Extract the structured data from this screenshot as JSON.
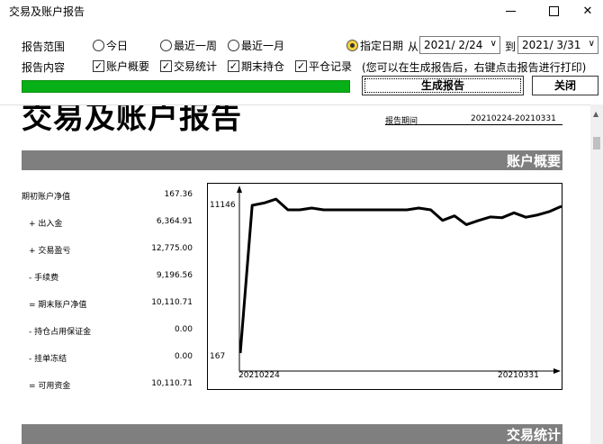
{
  "window": {
    "title": "交易及账户报告"
  },
  "controls": {
    "range_label": "报告范围",
    "content_label": "报告内容",
    "radios": [
      {
        "label": "今日",
        "checked": false
      },
      {
        "label": "最近一周",
        "checked": false
      },
      {
        "label": "最近一月",
        "checked": false
      },
      {
        "label": "指定日期",
        "checked": true
      }
    ],
    "from_label": "从",
    "to_label": "到",
    "from_date": "2021/ 2/24",
    "to_date": "2021/ 3/31",
    "checkboxes": [
      {
        "label": "账户概要",
        "checked": true
      },
      {
        "label": "交易统计",
        "checked": true
      },
      {
        "label": "期末持仓",
        "checked": true
      },
      {
        "label": "平仓记录",
        "checked": true
      }
    ],
    "hint": "(您可以在生成报告后，右键点击报告进行打印)",
    "progress": 1.0,
    "generate_button": "生成报告",
    "close_button": "关闭"
  },
  "report": {
    "title": "交易及账户报告",
    "period_label": "报告期间",
    "period_value": "20210224-20210331",
    "section_account": "账户概要",
    "section_stats": "交易统计",
    "summary": [
      {
        "label": "期初账户净值",
        "value": "167.36"
      },
      {
        "label": "+ 出入金",
        "value": "6,364.91"
      },
      {
        "label": "+ 交易盈亏",
        "value": "12,775.00"
      },
      {
        "label": "- 手续费",
        "value": "9,196.56"
      },
      {
        "label": "= 期末账户净值",
        "value": "10,110.71"
      },
      {
        "label": "- 持仓占用保证金",
        "value": "0.00"
      },
      {
        "label": "- 挂单冻结",
        "value": "0.00"
      },
      {
        "label": "= 可用资金",
        "value": "10,110.71"
      }
    ]
  },
  "chart_data": {
    "type": "line",
    "x_start_label": "20210224",
    "x_end_label": "20210331",
    "y_top_label": "11146",
    "y_bottom_label": "167",
    "ylim": [
      167,
      11146
    ],
    "values": [
      167,
      10950,
      11120,
      11400,
      10620,
      10620,
      10750,
      10620,
      10620,
      10620,
      10620,
      10620,
      10620,
      10620,
      10620,
      10750,
      10620,
      9850,
      10180,
      9540,
      9840,
      10100,
      10050,
      10400,
      10080,
      10250,
      10500,
      10880
    ]
  }
}
